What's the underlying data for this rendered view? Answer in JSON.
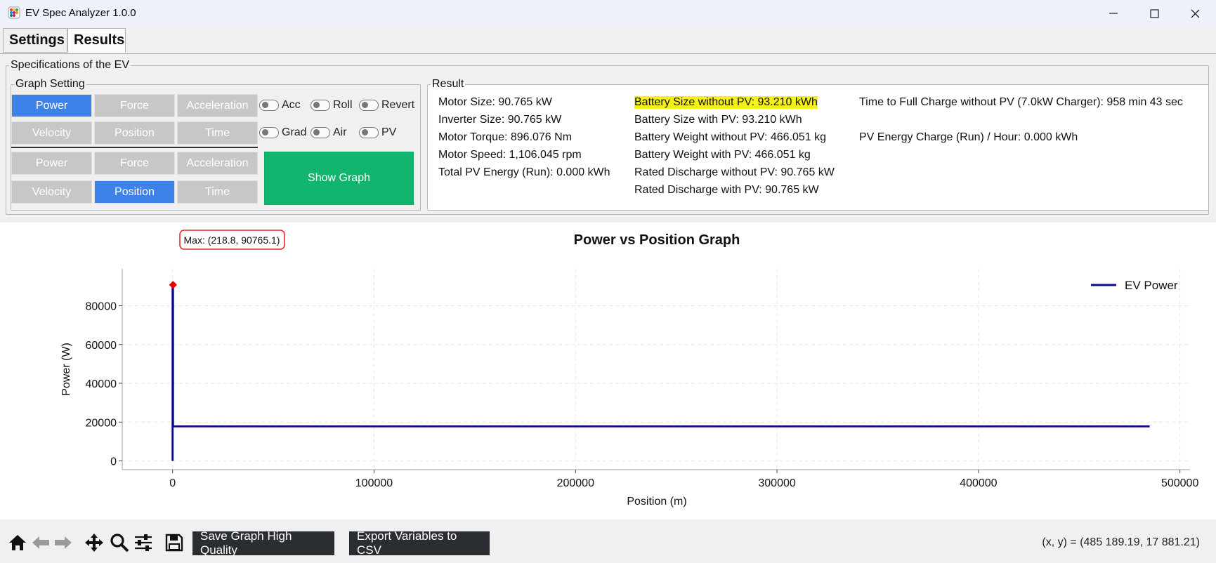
{
  "window": {
    "title": "EV Spec Analyzer 1.0.0"
  },
  "tabs": [
    {
      "label": "Settings"
    },
    {
      "label": "Results"
    }
  ],
  "specs": {
    "title": "Specifications of the EV"
  },
  "graph_setting": {
    "title": "Graph Setting",
    "y_buttons": [
      "Power",
      "Force",
      "Acceleration",
      "Velocity",
      "Position",
      "Time"
    ],
    "y_selected": "Power",
    "x_buttons": [
      "Power",
      "Force",
      "Acceleration",
      "Velocity",
      "Position",
      "Time"
    ],
    "x_selected": "Position",
    "toggles": [
      "Acc",
      "Roll",
      "Revert",
      "Grad",
      "Air",
      "PV"
    ],
    "show_graph": "Show Graph"
  },
  "result": {
    "title": "Result",
    "col1": [
      "Motor Size: 90.765 kW",
      "Inverter Size: 90.765 kW",
      "Motor Torque: 896.076 Nm",
      "Motor Speed: 1,106.045 rpm",
      "Total PV Energy (Run): 0.000 kWh"
    ],
    "col2": [
      "Battery Size without PV: 93.210 kWh",
      "Battery Size with PV: 93.210 kWh",
      "Battery Weight without PV: 466.051 kg",
      "Battery Weight with PV: 466.051 kg",
      "Rated Discharge without PV: 90.765 kW",
      "Rated Discharge with PV: 90.765 kW"
    ],
    "col3": [
      "Time to Full Charge without PV (7.0kW Charger): 958 min 43 sec",
      "PV Energy Charge (Run) / Hour: 0.000 kWh"
    ],
    "highlight_color": "#f5f016"
  },
  "chart_data": {
    "type": "line",
    "title": "Power vs Position Graph",
    "xlabel": "Position (m)",
    "ylabel": "Power (W)",
    "xlim": [
      -25000,
      505000
    ],
    "ylim": [
      -4500,
      99000
    ],
    "xticks": [
      0,
      100000,
      200000,
      300000,
      400000,
      500000
    ],
    "yticks": [
      0,
      20000,
      40000,
      60000,
      80000
    ],
    "grid": true,
    "legend_position": "top-right",
    "series": [
      {
        "name": "EV Power",
        "color": "#0a0a8a",
        "points": [
          [
            0,
            0
          ],
          [
            0,
            90765.1
          ],
          [
            218.8,
            90765.1
          ],
          [
            218.8,
            17800
          ],
          [
            485000,
            17800
          ]
        ]
      }
    ],
    "annotation": {
      "text": "Max: (218.8, 90765.1)",
      "x": 218.8,
      "y": 90765.1
    }
  },
  "toolbar": {
    "icons": [
      "home-icon",
      "back-icon",
      "forward-icon",
      "pan-icon",
      "zoom-icon",
      "configure-icon",
      "save-icon"
    ],
    "save_hq": "Save Graph High Quality",
    "export_csv": "Export Variables to CSV",
    "coords": "(x, y) = (485 189.19, 17 881.21)"
  }
}
